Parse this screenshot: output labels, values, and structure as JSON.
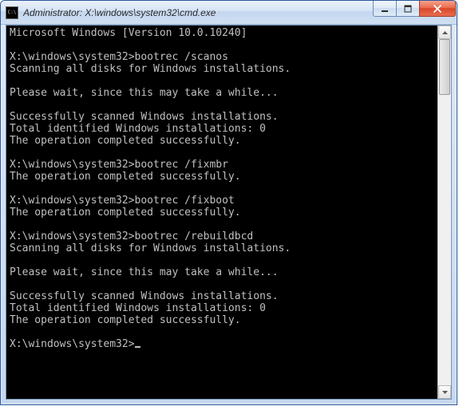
{
  "window": {
    "title": "Administrator: X:\\windows\\system32\\cmd.exe"
  },
  "terminal": {
    "prompt": "X:\\windows\\system32>",
    "lines": [
      "Microsoft Windows [Version 10.0.10240]",
      "",
      "X:\\windows\\system32>bootrec /scanos",
      "Scanning all disks for Windows installations.",
      "",
      "Please wait, since this may take a while...",
      "",
      "Successfully scanned Windows installations.",
      "Total identified Windows installations: 0",
      "The operation completed successfully.",
      "",
      "X:\\windows\\system32>bootrec /fixmbr",
      "The operation completed successfully.",
      "",
      "X:\\windows\\system32>bootrec /fixboot",
      "The operation completed successfully.",
      "",
      "X:\\windows\\system32>bootrec /rebuildbcd",
      "Scanning all disks for Windows installations.",
      "",
      "Please wait, since this may take a while...",
      "",
      "Successfully scanned Windows installations.",
      "Total identified Windows installations: 0",
      "The operation completed successfully.",
      ""
    ]
  }
}
